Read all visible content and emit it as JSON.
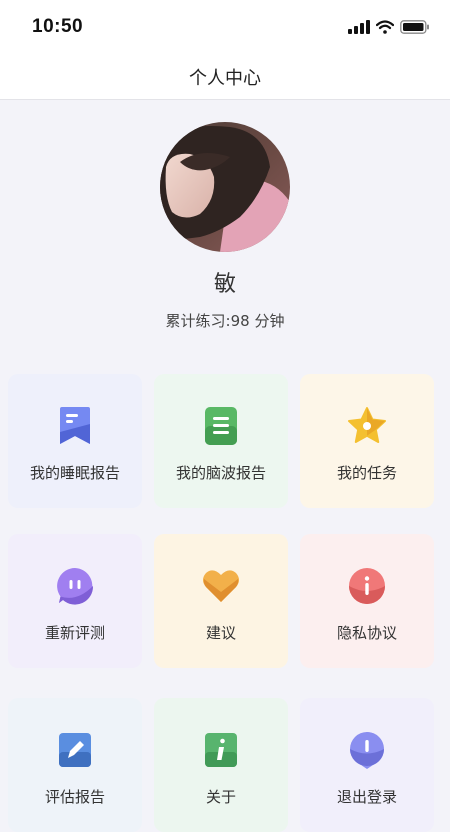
{
  "status_bar": {
    "time": "10:50"
  },
  "header": {
    "title": "个人中心"
  },
  "profile": {
    "name": "敏",
    "practice_text": "累计练习:98 分钟"
  },
  "grid": {
    "items": [
      {
        "label": "我的睡眠报告",
        "icon": "bookmark-icon",
        "color": "#6a7ff0",
        "bg": "#eef0fb"
      },
      {
        "label": "我的脑波报告",
        "icon": "document-icon",
        "color": "#54b65f",
        "bg": "#edf7f0"
      },
      {
        "label": "我的任务",
        "icon": "star-icon",
        "color": "#f2b531",
        "bg": "#fdf6e8"
      },
      {
        "label": "重新评测",
        "icon": "chat-bubble-icon",
        "color": "#9b78e8",
        "bg": "#f2eefb"
      },
      {
        "label": "建议",
        "icon": "heart-icon",
        "color": "#f0a540",
        "bg": "#fdf4e3"
      },
      {
        "label": "隐私协议",
        "icon": "info-icon",
        "color": "#ef6f6f",
        "bg": "#fcefef"
      },
      {
        "label": "评估报告",
        "icon": "edit-icon",
        "color": "#4c7fd4",
        "bg": "#eef3f9"
      },
      {
        "label": "关于",
        "icon": "about-icon",
        "color": "#4fab68",
        "bg": "#ecf6ef"
      },
      {
        "label": "退出登录",
        "icon": "logout-icon",
        "color": "#7b7fe0",
        "bg": "#f1effb"
      }
    ]
  }
}
